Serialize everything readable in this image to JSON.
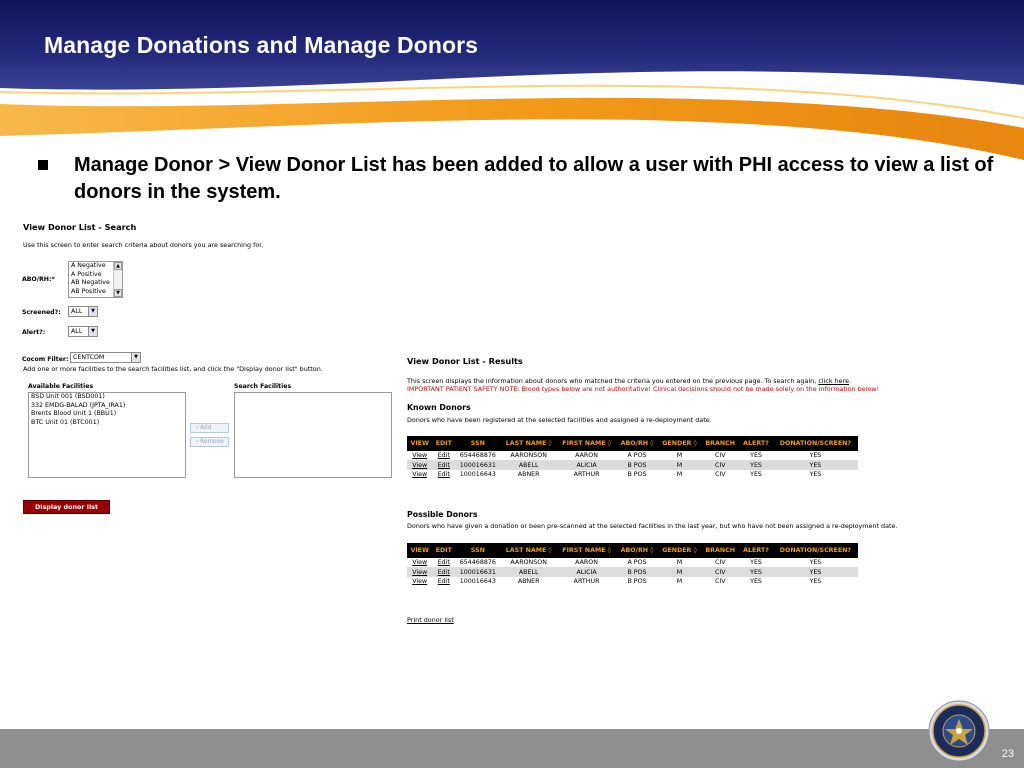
{
  "slide": {
    "title": "Manage Donations and Manage Donors",
    "bullet": "Manage Donor > View Donor List has been added to allow a user with PHI access to view a list of donors in the system.",
    "page_number": "23"
  },
  "search": {
    "title": "View Donor List - Search",
    "intro": "Use this screen to enter search criteria about donors you are searching for.",
    "abo_label": "ABO/RH:*",
    "abo_options": [
      "A Negative",
      "A Positive",
      "AB Negative",
      "AB Positive"
    ],
    "screened_label": "Screened?:",
    "screened_value": "ALL",
    "alert_label": "Alert?:",
    "alert_value": "ALL",
    "cocom_label": "Cocom Filter:",
    "cocom_value": "CENTCOM",
    "facilities_instruction": "Add one or more facilities to the search facilities list, and click the \"Display donor list\" button.",
    "available_label": "Available Facilities",
    "available_facilities": [
      "BSD Unit 001 (BSD001)",
      "332 EMDG-BALAD (JPTA_IRA1)",
      "Brents Blood Unit 1 (BBU1)",
      "BTC Unit 01 (BTC001)"
    ],
    "search_facilities_label": "Search Facilities",
    "add_label": "Add",
    "remove_label": "Remove",
    "display_button": "Display donor list"
  },
  "results": {
    "title": "View Donor List - Results",
    "intro_text": "This screen displays the information about donors who matched the criteria you entered on the previous page. To search again,",
    "click_here": "click here",
    "intro_end": ".",
    "warning": "IMPORTANT PATIENT SAFETY NOTE: Blood types below are not authoritative! Clinical decisions should not be made solely on the information below!",
    "known_title": "Known Donors",
    "known_desc": "Donors who have been registered at the selected facilities and assigned a re-deployment date.",
    "possible_title": "Possible Donors",
    "possible_desc": "Donors who have given a donation or been pre-scanned at the selected facilities in the last year, but who have not been assigned a re-deployment date.",
    "columns": [
      "VIEW",
      "EDIT",
      "SSN",
      "LAST NAME ◊",
      "FIRST NAME ◊",
      "ABO/RH ◊",
      "GENDER ◊",
      "BRANCH",
      "ALERT?",
      "DONATION/SCREEN?"
    ],
    "known_rows": [
      [
        "View",
        "Edit",
        "654468876",
        "AARONSON",
        "AARON",
        "A POS",
        "M",
        "CIV",
        "YES",
        "YES"
      ],
      [
        "View",
        "Edit",
        "100016631",
        "ABELL",
        "ALICIA",
        "B POS",
        "M",
        "CIV",
        "YES",
        "YES"
      ],
      [
        "View",
        "Edit",
        "100016643",
        "ABNER",
        "ARTHUR",
        "B POS",
        "M",
        "CIV",
        "YES",
        "YES"
      ]
    ],
    "possible_rows": [
      [
        "View",
        "Edit",
        "654468876",
        "AARONSON",
        "AARON",
        "A POS",
        "M",
        "CIV",
        "YES",
        "YES"
      ],
      [
        "View",
        "Edit",
        "100016631",
        "ABELL",
        "ALICIA",
        "B POS",
        "M",
        "CIV",
        "YES",
        "YES"
      ],
      [
        "View",
        "Edit",
        "100016643",
        "ABNER",
        "ARTHUR",
        "B POS",
        "M",
        "CIV",
        "YES",
        "YES"
      ]
    ],
    "print_link": "Print donor list"
  },
  "colors": {
    "header_navy": "#1f2470",
    "swoosh_orange": "#f29a1a",
    "table_header_bg": "#000000",
    "table_header_text": "#f0a000",
    "display_button_bg": "#990000",
    "footer_gray": "#8f8f8f"
  }
}
